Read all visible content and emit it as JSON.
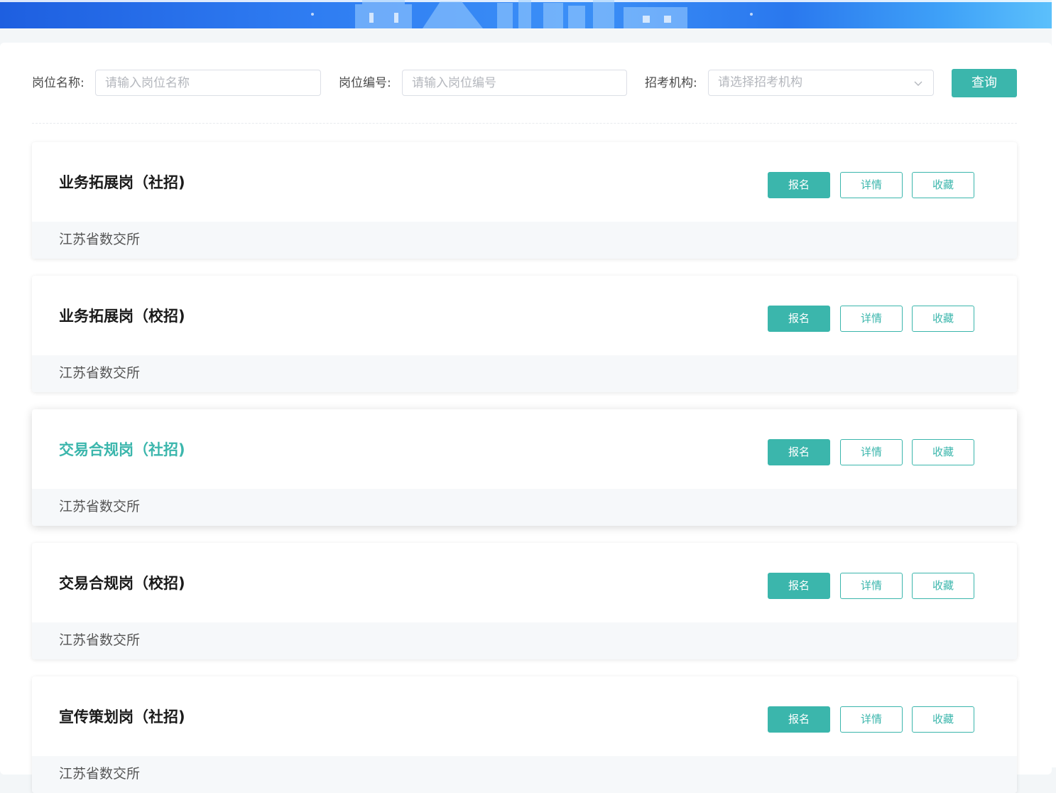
{
  "search": {
    "post_name_label": "岗位名称:",
    "post_name_placeholder": "请输入岗位名称",
    "post_code_label": "岗位编号:",
    "post_code_placeholder": "请输入岗位编号",
    "org_label": "招考机构:",
    "org_placeholder": "请选择招考机构",
    "query_label": "查询"
  },
  "jobs": [
    {
      "title": "业务拓展岗（社招)",
      "org": "江苏省数交所"
    },
    {
      "title": "业务拓展岗（校招)",
      "org": "江苏省数交所"
    },
    {
      "title": "交易合规岗（社招)",
      "org": "江苏省数交所"
    },
    {
      "title": "交易合规岗（校招)",
      "org": "江苏省数交所"
    },
    {
      "title": "宣传策划岗（社招)",
      "org": "江苏省数交所"
    }
  ],
  "actions": {
    "apply_label": "报名",
    "detail_label": "详情",
    "favorite_label": "收藏"
  },
  "colors": {
    "accent": "#3bb6ac",
    "banner": "#2f7df2"
  }
}
